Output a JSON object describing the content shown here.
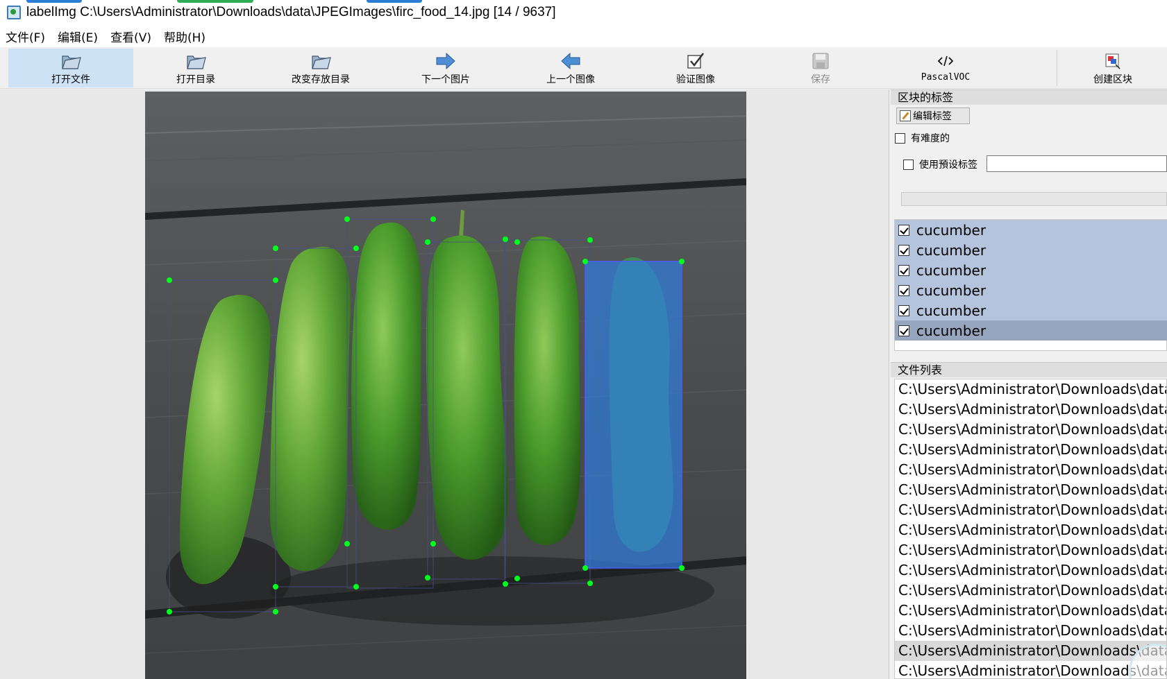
{
  "window": {
    "title": "labelImg C:\\Users\\Administrator\\Downloads\\data\\JPEGImages\\firc_food_14.jpg [14 / 9637]",
    "accent": "#2b7cd3"
  },
  "menu": {
    "items": [
      "文件(F)",
      "编辑(E)",
      "查看(V)",
      "帮助(H)"
    ]
  },
  "toolbar": {
    "open_file": "打开文件",
    "open_dir": "打开目录",
    "change_save_dir": "改变存放目录",
    "next_image": "下一个图片",
    "prev_image": "上一个图像",
    "verify_image": "验证图像",
    "save": "保存",
    "format": "PascalVOC",
    "create_box": "创建区块"
  },
  "panel": {
    "box_labels_title": "区块的标签",
    "edit_label_button": "编辑标签",
    "difficult_label": "有难度的",
    "use_default_label": "使用預设标签",
    "default_label_value": "",
    "labels": [
      "cucumber",
      "cucumber",
      "cucumber",
      "cucumber",
      "cucumber",
      "cucumber"
    ],
    "selected_label_index": 5,
    "file_list_title": "文件列表",
    "files": [
      "C:\\Users\\Administrator\\Downloads\\data\\",
      "C:\\Users\\Administrator\\Downloads\\data\\",
      "C:\\Users\\Administrator\\Downloads\\data\\",
      "C:\\Users\\Administrator\\Downloads\\data\\",
      "C:\\Users\\Administrator\\Downloads\\data\\",
      "C:\\Users\\Administrator\\Downloads\\data\\",
      "C:\\Users\\Administrator\\Downloads\\data\\",
      "C:\\Users\\Administrator\\Downloads\\data\\",
      "C:\\Users\\Administrator\\Downloads\\data\\",
      "C:\\Users\\Administrator\\Downloads\\data\\",
      "C:\\Users\\Administrator\\Downloads\\data\\",
      "C:\\Users\\Administrator\\Downloads\\data\\",
      "C:\\Users\\Administrator\\Downloads\\data\\",
      "C:\\Users\\Administrator\\Downloads\\data\\",
      "C:\\Users\\Administrator\\Downloads\\data\\"
    ],
    "selected_file_index": 13
  },
  "colors": {
    "label_row": "#b5c4dd",
    "label_row_selected": "#97a6bf",
    "box_selected_fill": "#2f7de0",
    "vertex": "#00ff1e"
  }
}
